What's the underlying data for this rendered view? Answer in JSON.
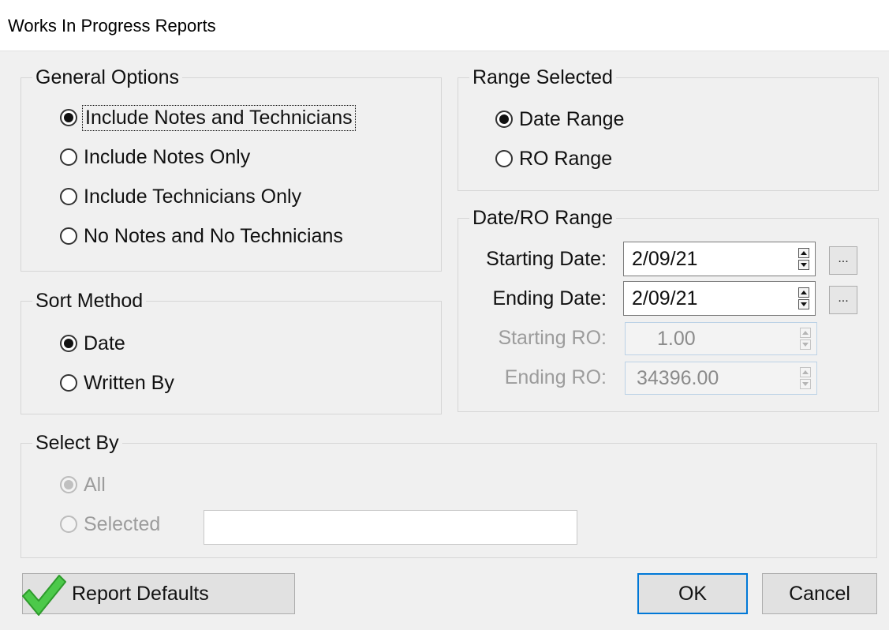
{
  "window": {
    "title": "Works In Progress Reports"
  },
  "general_options": {
    "legend": "General Options",
    "options": [
      {
        "label": "Include Notes and Technicians",
        "selected": true
      },
      {
        "label": "Include Notes Only",
        "selected": false
      },
      {
        "label": "Include Technicians Only",
        "selected": false
      },
      {
        "label": "No Notes and No Technicians",
        "selected": false
      }
    ]
  },
  "range_selected": {
    "legend": "Range Selected",
    "options": [
      {
        "label": "Date Range",
        "selected": true
      },
      {
        "label": "RO Range",
        "selected": false
      }
    ]
  },
  "date_ro_range": {
    "legend": "Date/RO Range",
    "starting_date_label": "Starting Date:",
    "starting_date_value": "2/09/21",
    "ending_date_label": "Ending Date:",
    "ending_date_value": "2/09/21",
    "starting_ro_label": "Starting RO:",
    "starting_ro_value": "1.00",
    "ending_ro_label": "Ending RO:",
    "ending_ro_value": "34396.00",
    "picker_label": "..."
  },
  "sort_method": {
    "legend": "Sort Method",
    "options": [
      {
        "label": "Date",
        "selected": true
      },
      {
        "label": "Written By",
        "selected": false
      }
    ]
  },
  "select_by": {
    "legend": "Select By",
    "options": [
      {
        "label": "All",
        "selected": true
      },
      {
        "label": "Selected",
        "selected": false
      }
    ],
    "selected_value": ""
  },
  "buttons": {
    "report_defaults": "Report Defaults",
    "ok": "OK",
    "cancel": "Cancel"
  },
  "colors": {
    "accent": "#0078d7",
    "check_icon": "#4cc94a"
  },
  "icons": {
    "report_defaults": "checkmark-icon",
    "picker": "ellipsis-icon"
  }
}
